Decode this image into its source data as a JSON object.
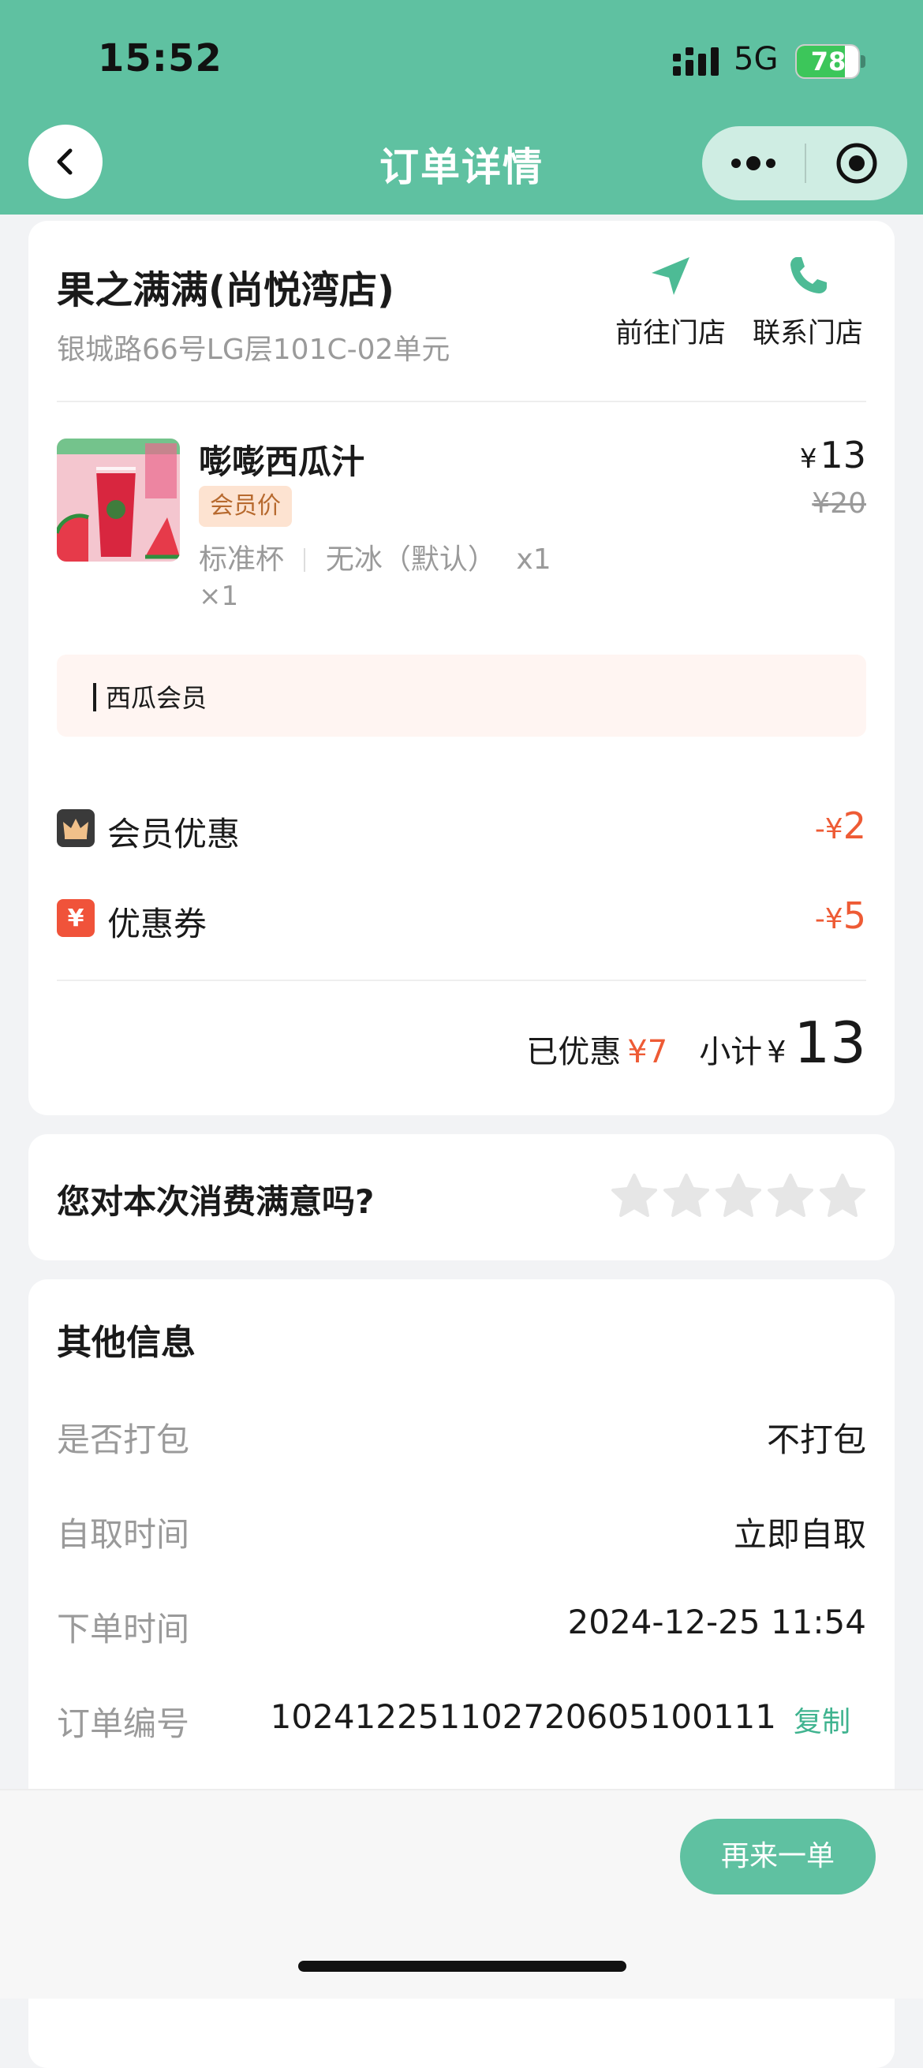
{
  "status_bar": {
    "time": "15:52",
    "network": "5G",
    "battery": "78",
    "battery_level": 0.78
  },
  "nav": {
    "title": "订单详情",
    "back_icon": "chevron-left-icon",
    "more_icon": "more-dots-icon",
    "close_icon": "target-circle-icon"
  },
  "store": {
    "name": "果之满满(尚悦湾店)",
    "address": "银城路66号LG层101C-02单元",
    "actions": [
      {
        "label": "前往门店",
        "icon": "navigation-arrow-icon"
      },
      {
        "label": "联系门店",
        "icon": "phone-icon"
      }
    ]
  },
  "product": {
    "name": "嘭嘭西瓜汁",
    "tag": "会员价",
    "spec_size": "标准杯",
    "spec_ice": "无冰（默认）",
    "spec_qty": "x1",
    "qty": "×1",
    "currency": "¥",
    "price": "13",
    "original_price": "¥20"
  },
  "member_banner": {
    "label": "西瓜会员"
  },
  "discounts": [
    {
      "label": "会员优惠",
      "prefix": "-¥",
      "value": "2",
      "icon": "crown-icon",
      "icon_color": "#3a3a3a"
    },
    {
      "label": "优惠券",
      "prefix": "-¥",
      "value": "5",
      "icon": "coupon-yen-icon",
      "icon_char": "¥",
      "icon_color": "#f0533a"
    }
  ],
  "summary": {
    "saved_label": "已优惠",
    "saved_value": "¥7",
    "subtotal_label": "小计",
    "currency": "¥",
    "subtotal_value": "13"
  },
  "rating": {
    "question": "您对本次消费满意吗?",
    "stars": 5,
    "selected": 0
  },
  "other_info": {
    "title": "其他信息",
    "rows": [
      {
        "label": "是否打包",
        "value": "不打包"
      },
      {
        "label": "自取时间",
        "value": "立即自取"
      },
      {
        "label": "下单时间",
        "value": "2024-12-25 11:54"
      },
      {
        "label": "订单编号",
        "value": "102412251102720605100111",
        "action": "复制"
      }
    ]
  },
  "footer": {
    "reorder_label": "再来一单"
  },
  "colors": {
    "brand": "#5fc1a1",
    "discount_red": "#ee5b35",
    "copy_green": "#3fb38f"
  }
}
